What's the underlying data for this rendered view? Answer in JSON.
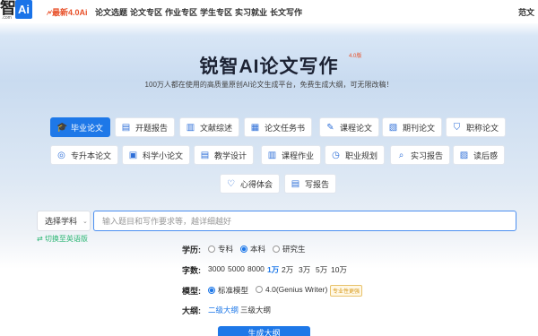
{
  "nav": {
    "logo_char": "智",
    "logo_sub": ".com",
    "logo_ai": "Ai",
    "items": [
      "最新4.0Ai",
      "论文选题",
      "论文专区",
      "作业专区",
      "学生专区",
      "实习就业",
      "长文写作"
    ],
    "right_link": "范文"
  },
  "hero": {
    "title": "锐智AI论文写作",
    "badge": "4.0版",
    "subtitle": "100万人都在使用的高质量原创AI论文生成平台，免费生成大纲，可无限改稿！"
  },
  "chips": [
    {
      "label": "毕业论文",
      "icon": "graduation-cap-icon",
      "active": true
    },
    {
      "label": "开题报告",
      "icon": "document-icon"
    },
    {
      "label": "文献综述",
      "icon": "book-icon"
    },
    {
      "label": "论文任务书",
      "icon": "task-icon"
    },
    {
      "label": "课程论文",
      "icon": "course-icon"
    },
    {
      "label": "期刊论文",
      "icon": "journal-icon"
    },
    {
      "label": "职称论文",
      "icon": "shield-icon"
    },
    {
      "label": "专升本论文",
      "icon": "upgrade-icon"
    },
    {
      "label": "科学小论文",
      "icon": "science-icon"
    },
    {
      "label": "教学设计",
      "icon": "teach-icon"
    },
    {
      "label": "课程作业",
      "icon": "homework-icon"
    },
    {
      "label": "职业规划",
      "icon": "career-icon"
    },
    {
      "label": "实习报告",
      "icon": "search-icon"
    },
    {
      "label": "读后感",
      "icon": "reading-icon"
    },
    {
      "label": "心得体会",
      "icon": "heart-icon"
    },
    {
      "label": "写报告",
      "icon": "report-icon"
    }
  ],
  "input": {
    "subject": "选择学科",
    "placeholder": "输入题目和写作要求等，越详细越好",
    "switch_lang": "⇄ 切换至英语版"
  },
  "options": {
    "education_label": "学历:",
    "education": [
      {
        "label": "专科",
        "selected": false
      },
      {
        "label": "本科",
        "selected": true
      },
      {
        "label": "研究生",
        "selected": false
      }
    ],
    "words_label": "字数:",
    "words": [
      {
        "label": "3000",
        "selected": false
      },
      {
        "label": "5000",
        "selected": false
      },
      {
        "label": "8000",
        "selected": false
      },
      {
        "label": "1万",
        "selected": true
      },
      {
        "label": "2万",
        "selected": false
      },
      {
        "label": "3万",
        "selected": false
      },
      {
        "label": "5万",
        "selected": false
      },
      {
        "label": "10万",
        "selected": false
      }
    ],
    "model_label": "模型:",
    "models": [
      {
        "label": "标准模型",
        "selected": true
      },
      {
        "label": "4.0(Genius Writer)",
        "selected": false
      }
    ],
    "model_tag": "专业性更强",
    "outline_label": "大纲:",
    "outlines": [
      {
        "label": "二级大纲",
        "selected": true
      },
      {
        "label": "三级大纲",
        "selected": false
      }
    ]
  },
  "generate_label": "生成大纲",
  "colors": {
    "accent": "#1e78e8",
    "new": "#e8512a",
    "green": "#2bb673"
  }
}
